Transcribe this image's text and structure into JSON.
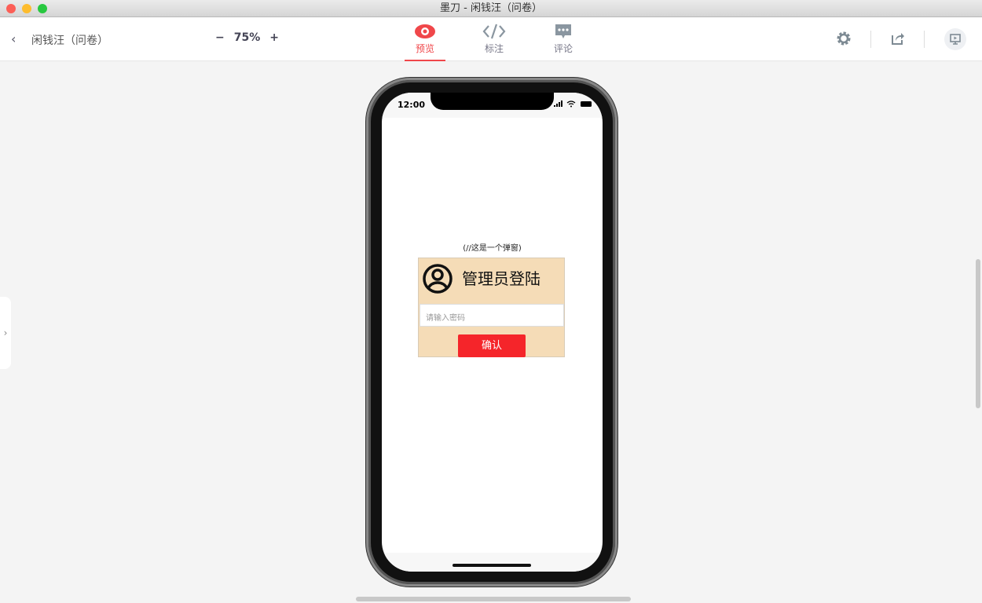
{
  "window": {
    "title": "墨刀 - 闲钱汪（问卷）"
  },
  "toolbar": {
    "project": "闲钱汪（问卷）",
    "zoom": "75%",
    "tabs": [
      {
        "label": "预览",
        "icon": "eye-icon"
      },
      {
        "label": "标注",
        "icon": "code-icon"
      },
      {
        "label": "评论",
        "icon": "comment-icon"
      }
    ]
  },
  "colors": {
    "accent": "#f0474a",
    "popup_bg": "#f5dcb7",
    "button": "#f5252a"
  },
  "phone": {
    "time": "12:00",
    "caption": "(//这是一个弹窗)",
    "popup": {
      "title": "管理员登陆",
      "placeholder": "请输入密码",
      "confirm": "确认"
    }
  }
}
